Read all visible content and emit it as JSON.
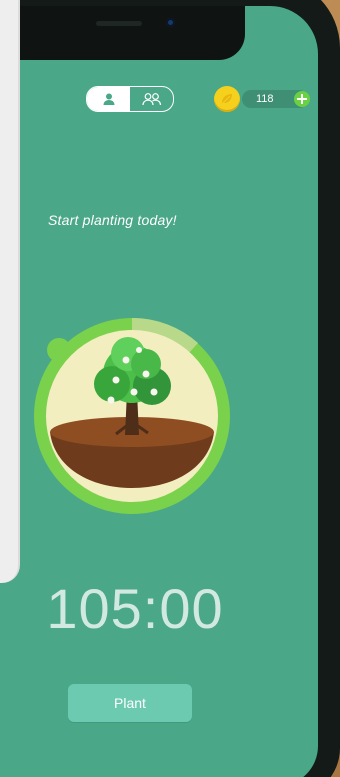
{
  "app": {
    "headline": "Start planting today!",
    "coin_count": "118",
    "timer": "105:00",
    "plant_button_label": "Plant"
  },
  "icons": {
    "single_user": "single-user-icon",
    "group_users": "group-users-icon",
    "coin": "coin-icon",
    "add_coin": "plus-icon"
  },
  "colors": {
    "screen_background": "#4aa788",
    "progress_ring": "#7ad14b",
    "coin_yellow": "#f5d01d",
    "button_background": "#6ccab0"
  }
}
